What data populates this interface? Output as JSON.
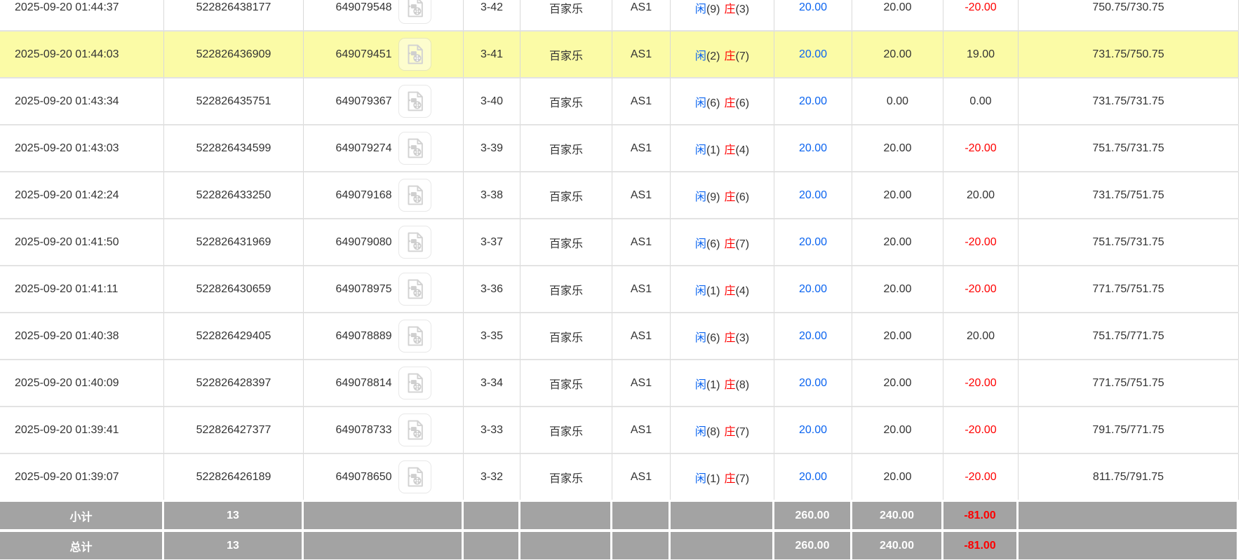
{
  "colors": {
    "link_blue": "#0b64f0",
    "loss_red": "#ff0000",
    "highlight_yellow": "#fbfba6",
    "summary_gray": "#a3a3a3"
  },
  "table": {
    "rows": [
      {
        "time": "2025-09-20 01:44:37",
        "bet_id": "522826438177",
        "round_id": "649079548",
        "table_round": "3-42",
        "game_name": "百家乐",
        "table_name": "AS1",
        "player_label": "闲",
        "player_value": "(9)",
        "banker_label": "庄",
        "banker_value": "(3)",
        "bet_amount": "20.00",
        "valid_amount": "20.00",
        "win_loss": "-20.00",
        "balance": "750.75/730.75",
        "highlight": false
      },
      {
        "time": "2025-09-20 01:44:03",
        "bet_id": "522826436909",
        "round_id": "649079451",
        "table_round": "3-41",
        "game_name": "百家乐",
        "table_name": "AS1",
        "player_label": "闲",
        "player_value": "(2)",
        "banker_label": "庄",
        "banker_value": "(7)",
        "bet_amount": "20.00",
        "valid_amount": "20.00",
        "win_loss": "19.00",
        "balance": "731.75/750.75",
        "highlight": true
      },
      {
        "time": "2025-09-20 01:43:34",
        "bet_id": "522826435751",
        "round_id": "649079367",
        "table_round": "3-40",
        "game_name": "百家乐",
        "table_name": "AS1",
        "player_label": "闲",
        "player_value": "(6)",
        "banker_label": "庄",
        "banker_value": "(6)",
        "bet_amount": "20.00",
        "valid_amount": "0.00",
        "win_loss": "0.00",
        "balance": "731.75/731.75",
        "highlight": false
      },
      {
        "time": "2025-09-20 01:43:03",
        "bet_id": "522826434599",
        "round_id": "649079274",
        "table_round": "3-39",
        "game_name": "百家乐",
        "table_name": "AS1",
        "player_label": "闲",
        "player_value": "(1)",
        "banker_label": "庄",
        "banker_value": "(4)",
        "bet_amount": "20.00",
        "valid_amount": "20.00",
        "win_loss": "-20.00",
        "balance": "751.75/731.75",
        "highlight": false
      },
      {
        "time": "2025-09-20 01:42:24",
        "bet_id": "522826433250",
        "round_id": "649079168",
        "table_round": "3-38",
        "game_name": "百家乐",
        "table_name": "AS1",
        "player_label": "闲",
        "player_value": "(9)",
        "banker_label": "庄",
        "banker_value": "(6)",
        "bet_amount": "20.00",
        "valid_amount": "20.00",
        "win_loss": "20.00",
        "balance": "731.75/751.75",
        "highlight": false
      },
      {
        "time": "2025-09-20 01:41:50",
        "bet_id": "522826431969",
        "round_id": "649079080",
        "table_round": "3-37",
        "game_name": "百家乐",
        "table_name": "AS1",
        "player_label": "闲",
        "player_value": "(6)",
        "banker_label": "庄",
        "banker_value": "(7)",
        "bet_amount": "20.00",
        "valid_amount": "20.00",
        "win_loss": "-20.00",
        "balance": "751.75/731.75",
        "highlight": false
      },
      {
        "time": "2025-09-20 01:41:11",
        "bet_id": "522826430659",
        "round_id": "649078975",
        "table_round": "3-36",
        "game_name": "百家乐",
        "table_name": "AS1",
        "player_label": "闲",
        "player_value": "(1)",
        "banker_label": "庄",
        "banker_value": "(4)",
        "bet_amount": "20.00",
        "valid_amount": "20.00",
        "win_loss": "-20.00",
        "balance": "771.75/751.75",
        "highlight": false
      },
      {
        "time": "2025-09-20 01:40:38",
        "bet_id": "522826429405",
        "round_id": "649078889",
        "table_round": "3-35",
        "game_name": "百家乐",
        "table_name": "AS1",
        "player_label": "闲",
        "player_value": "(6)",
        "banker_label": "庄",
        "banker_value": "(3)",
        "bet_amount": "20.00",
        "valid_amount": "20.00",
        "win_loss": "20.00",
        "balance": "751.75/771.75",
        "highlight": false
      },
      {
        "time": "2025-09-20 01:40:09",
        "bet_id": "522826428397",
        "round_id": "649078814",
        "table_round": "3-34",
        "game_name": "百家乐",
        "table_name": "AS1",
        "player_label": "闲",
        "player_value": "(1)",
        "banker_label": "庄",
        "banker_value": "(8)",
        "bet_amount": "20.00",
        "valid_amount": "20.00",
        "win_loss": "-20.00",
        "balance": "771.75/751.75",
        "highlight": false
      },
      {
        "time": "2025-09-20 01:39:41",
        "bet_id": "522826427377",
        "round_id": "649078733",
        "table_round": "3-33",
        "game_name": "百家乐",
        "table_name": "AS1",
        "player_label": "闲",
        "player_value": "(8)",
        "banker_label": "庄",
        "banker_value": "(7)",
        "bet_amount": "20.00",
        "valid_amount": "20.00",
        "win_loss": "-20.00",
        "balance": "791.75/771.75",
        "highlight": false
      },
      {
        "time": "2025-09-20 01:39:07",
        "bet_id": "522826426189",
        "round_id": "649078650",
        "table_round": "3-32",
        "game_name": "百家乐",
        "table_name": "AS1",
        "player_label": "闲",
        "player_value": "(1)",
        "banker_label": "庄",
        "banker_value": "(7)",
        "bet_amount": "20.00",
        "valid_amount": "20.00",
        "win_loss": "-20.00",
        "balance": "811.75/791.75",
        "highlight": false
      }
    ],
    "subtotal": {
      "label": "小计",
      "count": "13",
      "bet_total": "260.00",
      "valid_total": "240.00",
      "win_loss_total": "-81.00"
    },
    "total": {
      "label": "总计",
      "count": "13",
      "bet_total": "260.00",
      "valid_total": "240.00",
      "win_loss_total": "-81.00"
    }
  }
}
